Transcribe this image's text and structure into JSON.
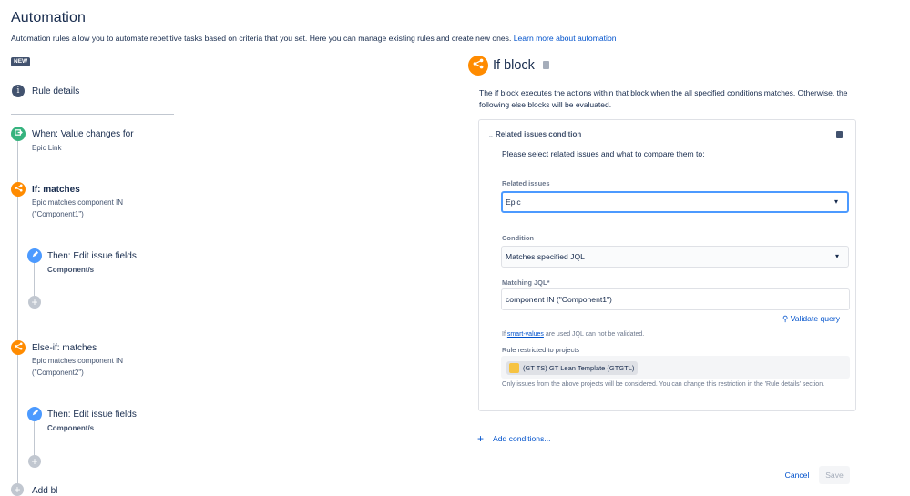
{
  "page": {
    "title": "Automation",
    "description": "Automation rules allow you to automate repetitive tasks based on criteria that you set. Here you can manage existing rules and create new ones.",
    "learn_more": "Learn more about automation",
    "new_badge": "NEW"
  },
  "sidebar": {
    "rule_details": "Rule details",
    "trigger": {
      "title": "When: Value changes for",
      "sub": "Epic Link"
    },
    "if_block": {
      "title": "If: matches",
      "sub1": "Epic matches component IN",
      "sub2": "(\"Component1\")"
    },
    "then1": {
      "title": "Then: Edit issue fields",
      "sub": "Component/s"
    },
    "elseif": {
      "title": "Else-if: matches",
      "sub1": "Epic matches component IN",
      "sub2": "(\"Component2\")"
    },
    "then2": {
      "title": "Then: Edit issue fields",
      "sub": "Component/s"
    },
    "add_partial": "Add bl"
  },
  "panel": {
    "title": "If block",
    "description": "The if block executes the actions within that block when the all specified conditions matches. Otherwise, the following else blocks will be evaluated.",
    "condition_card": {
      "header": "Related issues condition",
      "prompt": "Please select related issues and what to compare them to:",
      "related_label": "Related issues",
      "related_value": "Epic",
      "condition_label": "Condition",
      "condition_value": "Matches specified JQL",
      "jql_label": "Matching JQL*",
      "jql_value": "component IN (\"Component1\")",
      "validate": "Validate query",
      "sv_prefix": "If",
      "sv_link": "smart-values",
      "sv_suffix": "are used JQL can not be validated.",
      "restricted_label": "Rule restricted to projects",
      "project": "(GT TS) GT Lean Template (GTGTL)",
      "only_note": "Only issues from the above projects will be considered. You can change this restriction in the 'Rule details' section."
    },
    "add_conditions": "Add conditions...",
    "cancel": "Cancel",
    "save": "Save"
  }
}
